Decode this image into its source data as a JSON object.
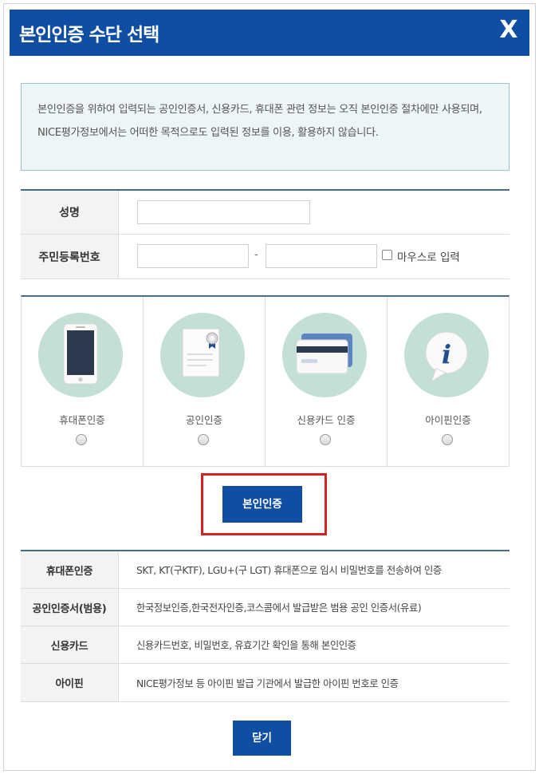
{
  "dialog": {
    "title": "본인인증 수단 선택",
    "close_glyph": "X"
  },
  "notice": {
    "text": "본인인증을 위하여 입력되는 공인인증서, 신용카드, 휴대폰 관련 정보는 오직 본인인증 절차에만 사용되며, NICE평가정보에서는 어떠한 목적으로도 입력된 정보를 이용, 활용하지 않습니다."
  },
  "form": {
    "name_label": "성명",
    "name_value": "",
    "rrn_label": "주민등록번호",
    "rrn_front_value": "",
    "rrn_separator": "-",
    "rrn_back_value": "",
    "mouse_input_label": "마우스로 입력",
    "mouse_input_checked": false
  },
  "methods": [
    {
      "label": "휴대폰인증",
      "icon": "smartphone-icon",
      "selected": false
    },
    {
      "label": "공인인증",
      "icon": "certificate-icon",
      "selected": false
    },
    {
      "label": "신용카드 인증",
      "icon": "credit-card-icon",
      "selected": false
    },
    {
      "label": "아이핀인증",
      "icon": "ipin-info-icon",
      "selected": false
    }
  ],
  "verify_button": "본인인증",
  "info_table": [
    {
      "label": "휴대폰인증",
      "desc": "SKT, KT(구KTF), LGU+(구 LGT) 휴대폰으로 임시 비밀번호를 전송하여 인증"
    },
    {
      "label": "공인인증서(범용)",
      "desc": "한국정보인증,한국전자인증,코스콤에서 발급받은 범용 공인 인증서(유료)"
    },
    {
      "label": "신용카드",
      "desc": "신용카드번호, 비밀번호, 유효기간 확인을 통해 본인인증"
    },
    {
      "label": "아이핀",
      "desc": "NICE평가정보 등 아이핀 발급 기관에서 발급한 아이핀 번호로 인증"
    }
  ],
  "close_button": "닫기",
  "colors": {
    "primary": "#0f4ea3",
    "icon_circle": "#c4ded8",
    "highlight_border": "#d42121",
    "notice_bg": "#eef5f7"
  }
}
